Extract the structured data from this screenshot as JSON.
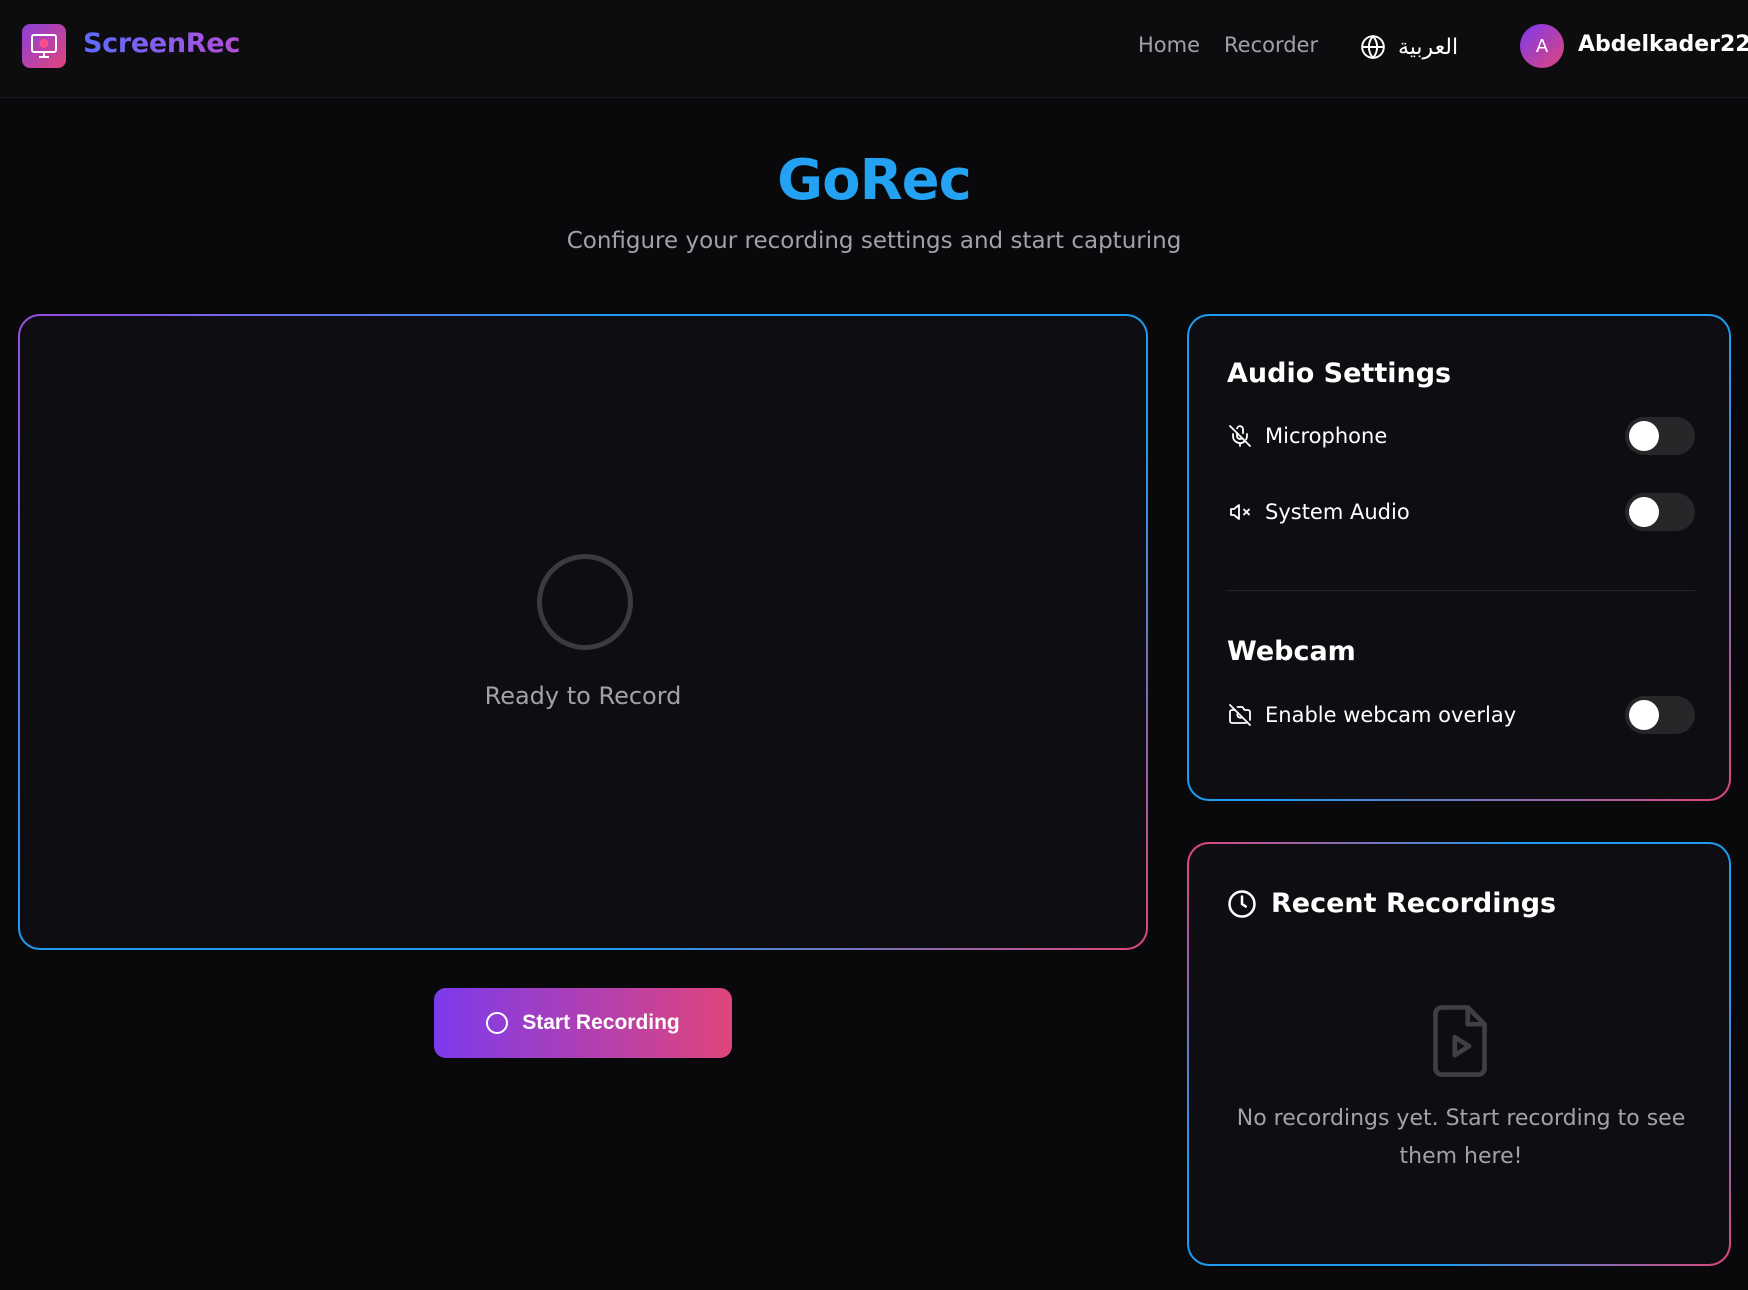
{
  "header": {
    "brand": "ScreenRec",
    "nav": {
      "home": "Home",
      "recorder": "Recorder"
    },
    "language": "العربية",
    "user": {
      "initial": "A",
      "name": "Abdelkader22"
    }
  },
  "hero": {
    "title": "GoRec",
    "subtitle": "Configure your recording settings and start capturing"
  },
  "preview": {
    "status": "Ready to Record"
  },
  "actions": {
    "start_label": "Start Recording"
  },
  "settings": {
    "audio_title": "Audio Settings",
    "microphone": {
      "label": "Microphone",
      "enabled": false,
      "icon": "mic-off-icon"
    },
    "system_audio": {
      "label": "System Audio",
      "enabled": false,
      "icon": "volume-x-icon"
    },
    "webcam_title": "Webcam",
    "webcam_overlay": {
      "label": "Enable webcam overlay",
      "enabled": false,
      "icon": "camera-off-icon"
    }
  },
  "recent": {
    "title": "Recent Recordings",
    "empty_message": "No recordings yet. Start recording to see them here!"
  },
  "colors": {
    "background": "#09090b",
    "accent_blue": "#1d9bf0",
    "accent_purple": "#7c3aed",
    "accent_pink": "#e0457b"
  }
}
